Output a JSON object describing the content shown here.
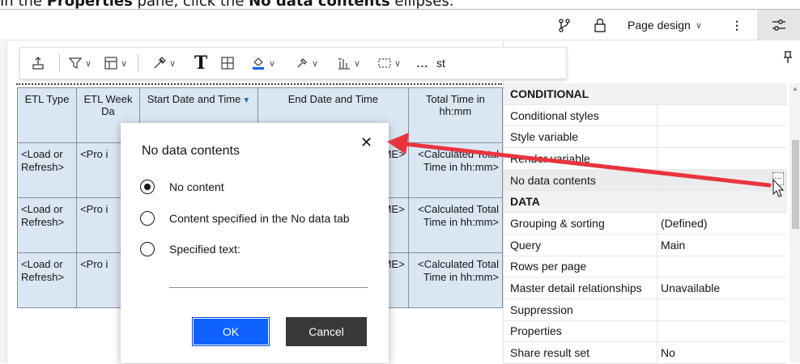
{
  "instruction": {
    "prefix": "In the ",
    "pane": "Properties",
    "middle": " pane, click the ",
    "item": "No data contents",
    "suffix": " ellipses."
  },
  "topbar": {
    "page_design_label": "Page design",
    "more_label": "⋮"
  },
  "toolbar": {
    "more_label": "...",
    "props_label_fragment": "st"
  },
  "report": {
    "headers": [
      "ETL Type",
      "ETL Week Da",
      "Start Date and Time",
      "End Date and Time",
      "Total Time in hh:mm"
    ],
    "rows": [
      [
        "<Load or Refresh>",
        "<Pro i",
        "",
        "ME>",
        "<Calculated Total Time in hh:mm>"
      ],
      [
        "<Load or Refresh>",
        "<Pro i",
        "",
        "ME>",
        "<Calculated Total Time in hh:mm>"
      ],
      [
        "<Load or Refresh>",
        "<Pro i",
        "",
        "ME>",
        "<Calculated Total Time in hh:mm>"
      ]
    ]
  },
  "properties": {
    "sections": [
      {
        "title": "CONDITIONAL",
        "rows": [
          {
            "name": "Conditional styles",
            "value": ""
          },
          {
            "name": "Style variable",
            "value": ""
          },
          {
            "name": "Render variable",
            "value": ""
          },
          {
            "name": "No data contents",
            "value": ""
          }
        ]
      },
      {
        "title": "DATA",
        "rows": [
          {
            "name": "Grouping & sorting",
            "value": "(Defined)"
          },
          {
            "name": "Query",
            "value": "Main"
          },
          {
            "name": "Rows per page",
            "value": ""
          },
          {
            "name": "Master detail relationships",
            "value": "Unavailable"
          },
          {
            "name": "Suppression",
            "value": ""
          },
          {
            "name": "Properties",
            "value": ""
          },
          {
            "name": "Share result set",
            "value": "No"
          }
        ]
      }
    ],
    "ellipsis_label": "..."
  },
  "dialog": {
    "title": "No data contents",
    "close_label": "✕",
    "options": [
      {
        "label": "No content",
        "selected": true
      },
      {
        "label": "Content specified in the No data tab",
        "selected": false
      },
      {
        "label": "Specified text:",
        "selected": false
      }
    ],
    "ok_label": "OK",
    "cancel_label": "Cancel"
  },
  "colors": {
    "accent": "#0f62fe",
    "arrow": "#e8343e",
    "table_fill": "#dbe6f3"
  }
}
